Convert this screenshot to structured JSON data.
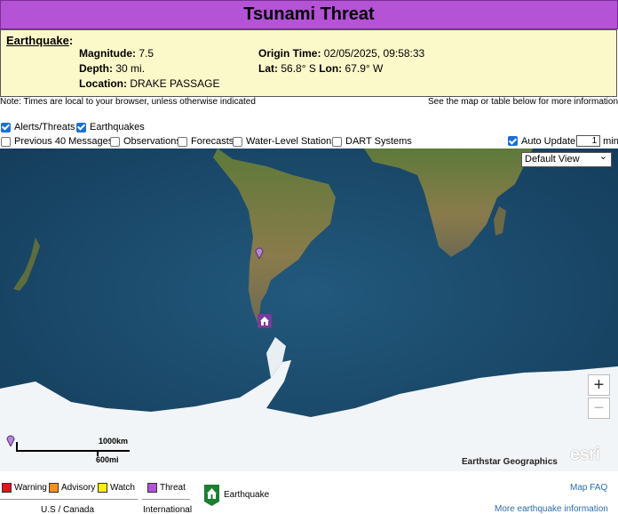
{
  "title": "Tsunami Threat",
  "earthquake": {
    "heading": "Earthquake",
    "magnitude_label": "Magnitude:",
    "magnitude_value": "7.5",
    "depth_label": "Depth:",
    "depth_value": "30 mi.",
    "location_label": "Location:",
    "location_value": "DRAKE PASSAGE",
    "origin_label": "Origin Time:",
    "origin_value": "02/05/2025, 09:58:33",
    "lat_label": "Lat:",
    "lat_value": "56.8° S",
    "lon_label": "Lon:",
    "lon_value": "67.9° W"
  },
  "notes": {
    "left": "Note: Times are local to your browser, unless otherwise indicated",
    "right": "See the map or table below for more information"
  },
  "filters": {
    "alerts": {
      "label": "Alerts/Threats",
      "checked": true
    },
    "earthquakes": {
      "label": "Earthquakes",
      "checked": true
    },
    "previous": {
      "label": "Previous 40 Messages",
      "checked": false
    },
    "observations": {
      "label": "Observations",
      "checked": false
    },
    "forecasts": {
      "label": "Forecasts",
      "checked": false
    },
    "water_level": {
      "label": "Water-Level Stations",
      "checked": false
    },
    "dart": {
      "label": "DART Systems",
      "checked": false
    },
    "auto_update": {
      "label": "Auto Update",
      "checked": true,
      "value": "1",
      "unit": "min"
    }
  },
  "map": {
    "view_select": "Default View",
    "zoom_in": "+",
    "zoom_out": "−",
    "scale_km": "1000km",
    "scale_mi": "600mi",
    "attribution": "Earthstar Geographics",
    "logo": "esri",
    "ocean_color": "#1c4f73",
    "ice_color": "#f2f5f7",
    "land_color": "#7d7a3e"
  },
  "legend": {
    "warning": {
      "label": "Warning",
      "color": "#e8101a"
    },
    "advisory": {
      "label": "Advisory",
      "color": "#f5901e"
    },
    "watch": {
      "label": "Watch",
      "color": "#fff200"
    },
    "threat": {
      "label": "Threat",
      "color": "#b453d6"
    },
    "us_canada": "U.S / Canada",
    "international": "International",
    "earthquake": "Earthquake",
    "earthquake_icon_color": "#1a7f2e"
  },
  "links": {
    "faq": "Map FAQ",
    "more": "More earthquake information"
  }
}
